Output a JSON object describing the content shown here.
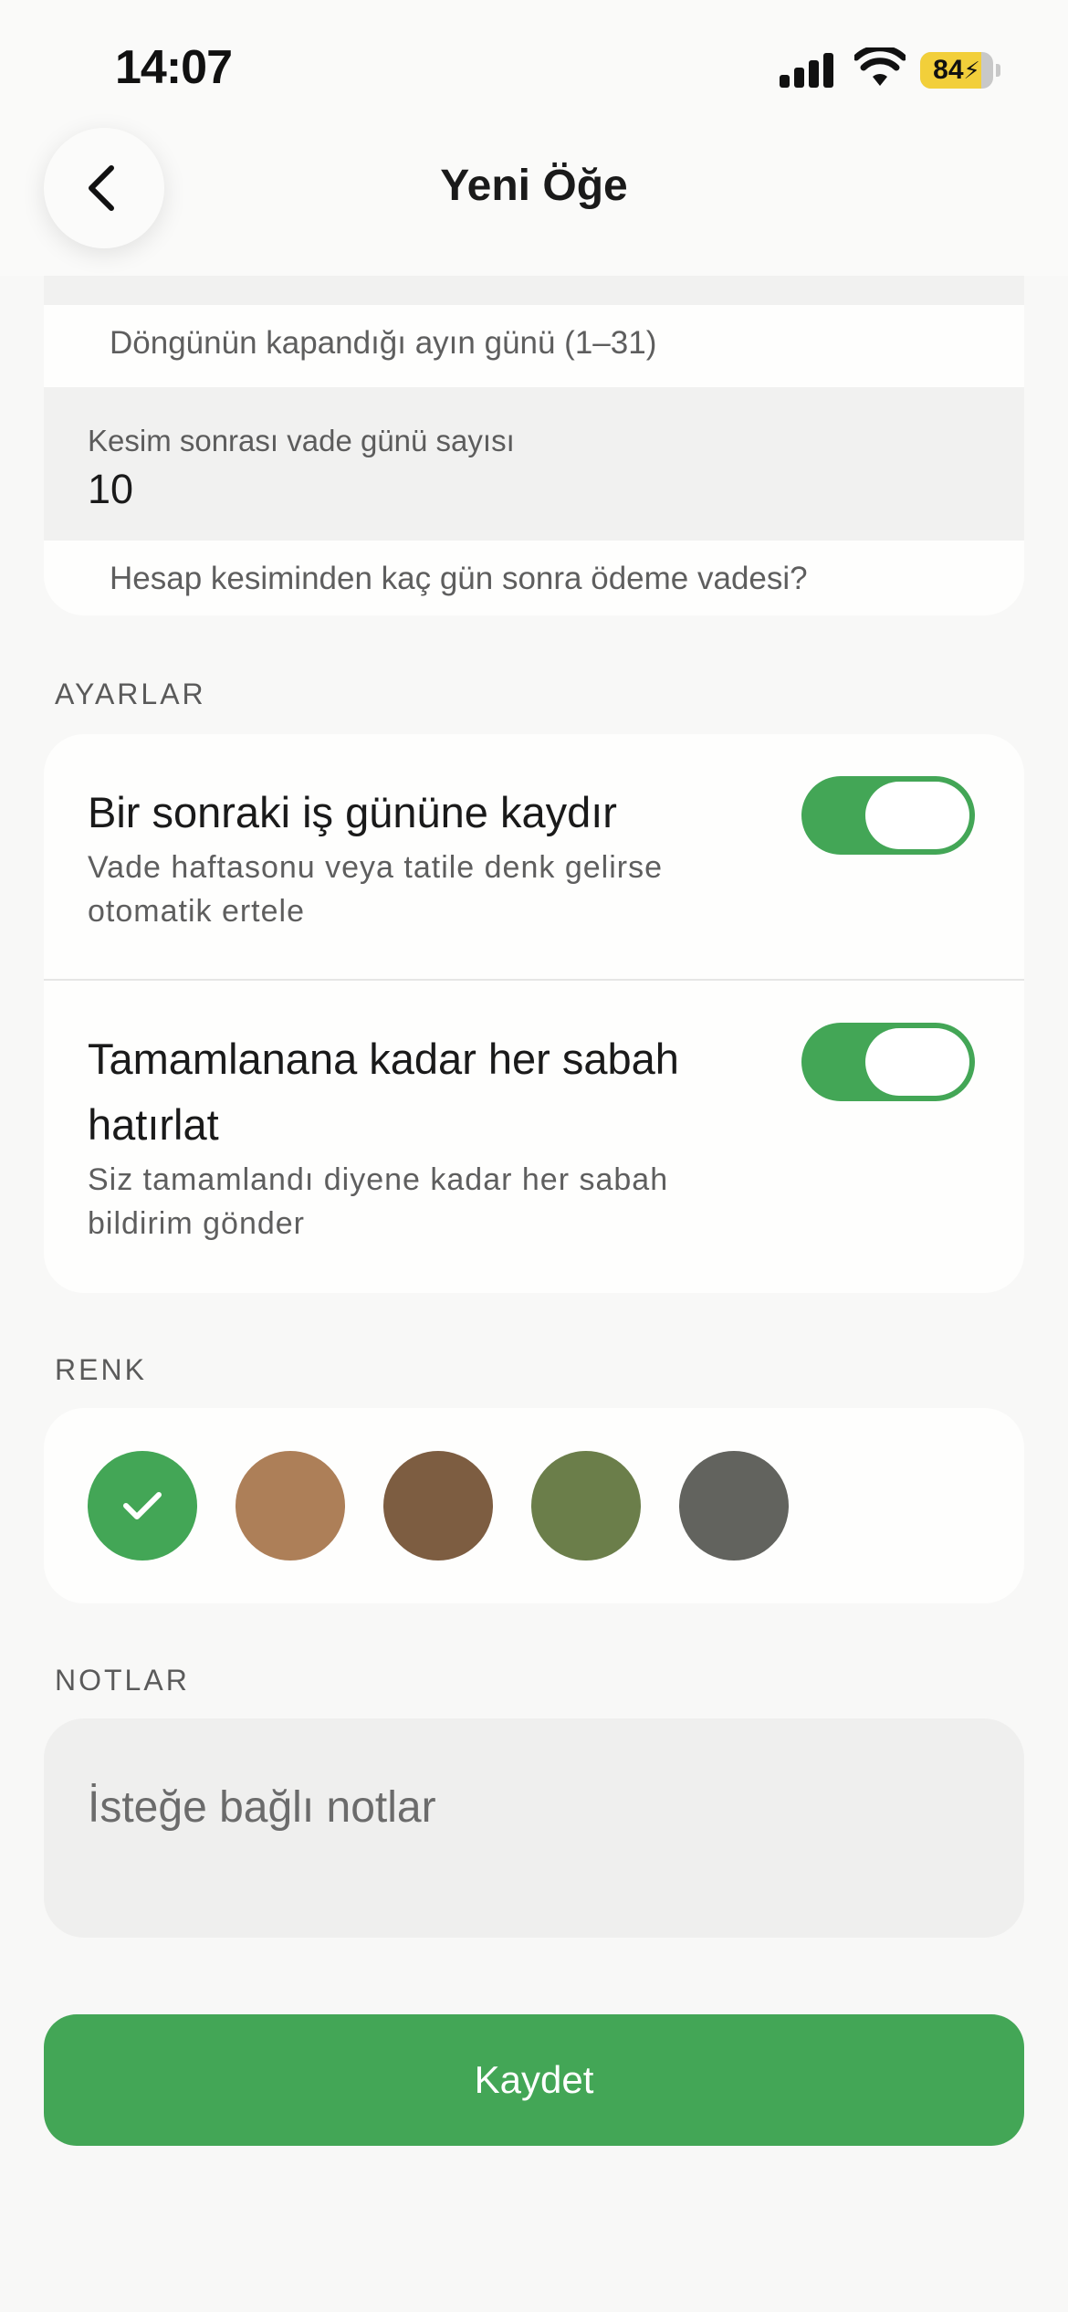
{
  "status_bar": {
    "time": "14:07",
    "battery_label": "84",
    "battery_level": 0.84
  },
  "header": {
    "title": "Yeni Öğe",
    "back_icon": "chevron-left-icon"
  },
  "cycle_close_day": {
    "hint": "Döngünün kapandığı ayın günü (1–31)"
  },
  "due_days": {
    "label": "Kesim sonrası vade günü sayısı",
    "value": "10",
    "hint": "Hesap kesiminden kaç gün sonra ödeme vadesi?"
  },
  "settings": {
    "section_title": "AYARLAR",
    "items": [
      {
        "title": "Bir sonraki iş gününe kaydır",
        "subtitle": "Vade haftasonu veya tatile denk gelirse otomatik ertele",
        "enabled": true
      },
      {
        "title": "Tamamlanana kadar her sabah hatırlat",
        "subtitle": "Siz tamamlandı diyene kadar her sabah bildirim gönder",
        "enabled": true
      }
    ]
  },
  "color": {
    "section_title": "RENK",
    "selected_index": 0,
    "swatches": [
      "#43a656",
      "#ad7f58",
      "#7d5d41",
      "#6b7e4a",
      "#62635e"
    ]
  },
  "notes": {
    "section_title": "NOTLAR",
    "placeholder": "İsteğe bağlı notlar",
    "value": ""
  },
  "save_button": {
    "label": "Kaydet"
  },
  "colors": {
    "accent": "#43a656",
    "background": "#f8f8f7",
    "card": "#fefefd",
    "field": "#f1f1f0"
  }
}
